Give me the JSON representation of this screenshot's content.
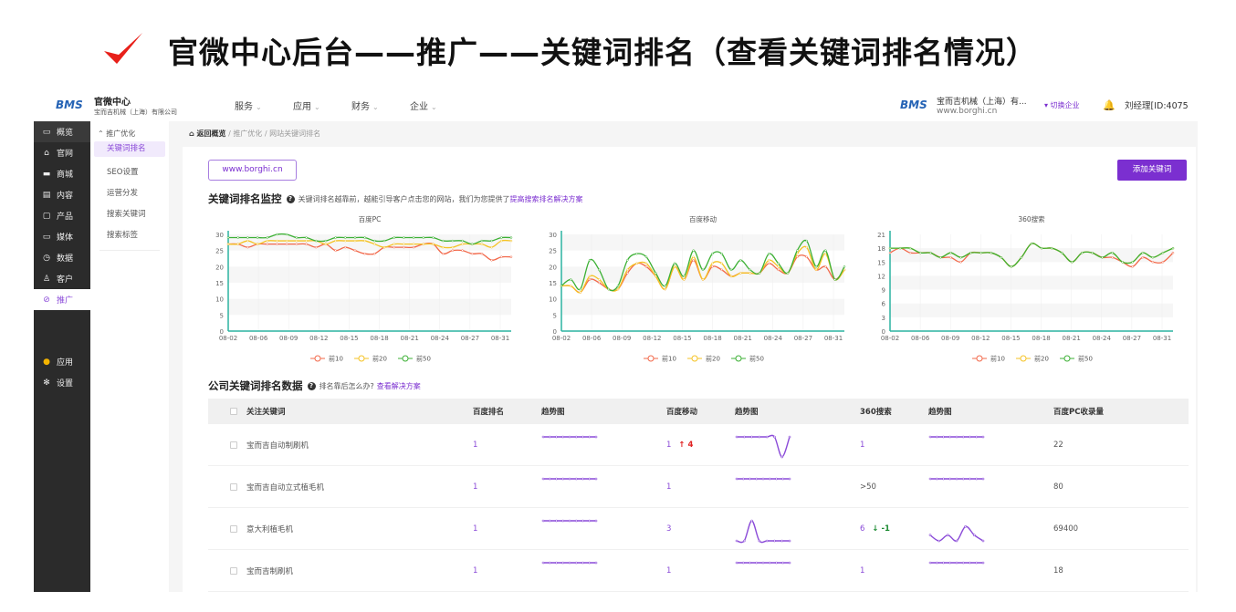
{
  "headline": {
    "text": "官微中心后台——推广——关键词排名（查看关键词排名情况）",
    "check_color": "#e8201a"
  },
  "topbar": {
    "logo": "BMS",
    "brand_title": "官微中心",
    "brand_sub": "宝而吉机械（上海）有限公司",
    "nav": [
      "服务",
      "应用",
      "财务",
      "企业"
    ],
    "company_name": "宝而吉机械（上海）有...",
    "company_site": "www.borghi.cn",
    "switch_label": "▾ 切换企业",
    "user": "刘经理[ID:4075"
  },
  "sidebar": {
    "items": [
      {
        "icon": "overview-icon",
        "glyph": "▭",
        "label": "概览"
      },
      {
        "icon": "website-icon",
        "glyph": "⌂",
        "label": "官网"
      },
      {
        "icon": "shop-icon",
        "glyph": "▬",
        "label": "商城"
      },
      {
        "icon": "content-icon",
        "glyph": "▤",
        "label": "内容"
      },
      {
        "icon": "product-icon",
        "glyph": "▢",
        "label": "产品"
      },
      {
        "icon": "media-icon",
        "glyph": "▭",
        "label": "媒体"
      },
      {
        "icon": "data-icon",
        "glyph": "◷",
        "label": "数据"
      },
      {
        "icon": "customer-icon",
        "glyph": "♙",
        "label": "客户"
      },
      {
        "icon": "promotion-icon",
        "glyph": "⊘",
        "label": "推广"
      }
    ],
    "bottom": [
      {
        "icon": "apps-icon",
        "glyph": "●",
        "label": "应用"
      },
      {
        "icon": "settings-icon",
        "glyph": "✻",
        "label": "设置"
      }
    ]
  },
  "subnav": {
    "group": "推广优化",
    "items": [
      "关键词排名",
      "SEO设置",
      "运营分发",
      "搜索关键词",
      "搜索标签"
    ]
  },
  "breadcrumb": [
    "返回概览",
    "推广优化",
    "网站关键词排名"
  ],
  "main": {
    "site_button": "www.borghi.cn",
    "add_button": "添加关键词",
    "monitor_title": "关键词排名监控",
    "monitor_desc": "关键词排名越靠前，越能引导客户点击您的网站，我们为您提供了",
    "monitor_link": "提高搜索排名解决方案",
    "table_title": "公司关键词排名数据",
    "table_desc": "排名靠后怎么办?",
    "table_link": "查看解决方案"
  },
  "chart_data": [
    {
      "type": "line",
      "title": "百度PC",
      "x_ticks": [
        "08-02",
        "08-06",
        "08-09",
        "08-12",
        "08-15",
        "08-18",
        "08-21",
        "08-24",
        "08-27",
        "08-31"
      ],
      "ylim": [
        0,
        30
      ],
      "yticks": [
        0,
        5,
        10,
        15,
        20,
        25,
        30
      ],
      "legend": "bottom",
      "series": [
        {
          "name": "前10",
          "color": "#f2684a",
          "values": [
            27,
            27,
            26,
            27,
            27,
            27,
            27,
            27,
            27,
            26,
            27,
            25,
            26,
            25,
            24,
            24,
            26,
            26,
            26,
            26,
            27,
            27,
            24,
            25,
            25,
            24,
            24,
            22,
            23,
            23
          ]
        },
        {
          "name": "前20",
          "color": "#f5c324",
          "values": [
            27,
            27,
            28,
            27,
            28,
            28,
            28,
            28,
            28,
            28,
            27,
            28,
            28,
            28,
            28,
            27,
            26,
            27,
            27,
            27,
            27,
            27,
            26,
            26,
            27,
            27,
            27,
            26,
            28,
            28
          ]
        },
        {
          "name": "前50",
          "color": "#3cb034",
          "values": [
            29,
            29,
            29,
            29,
            29,
            30,
            30,
            29,
            29,
            28,
            28,
            29,
            29,
            29,
            29,
            28,
            28,
            29,
            29,
            29,
            29,
            29,
            28,
            28,
            28,
            27,
            28,
            28,
            29,
            29
          ]
        }
      ]
    },
    {
      "type": "line",
      "title": "百度移动",
      "x_ticks": [
        "08-02",
        "08-06",
        "08-09",
        "08-12",
        "08-15",
        "08-18",
        "08-21",
        "08-24",
        "08-27",
        "08-31"
      ],
      "ylim": [
        0,
        30
      ],
      "yticks": [
        0,
        5,
        10,
        15,
        20,
        25,
        30
      ],
      "legend": "bottom",
      "series": [
        {
          "name": "前10",
          "color": "#f2684a",
          "values": [
            14,
            14,
            12,
            16,
            15,
            13,
            13,
            18,
            21,
            20,
            17,
            13,
            20,
            16,
            22,
            16,
            20,
            19,
            17,
            18,
            18,
            18,
            21,
            19,
            18,
            23,
            23,
            19,
            20,
            16,
            19
          ]
        },
        {
          "name": "前20",
          "color": "#f5c324",
          "values": [
            14,
            14,
            12,
            17,
            16,
            13,
            13,
            19,
            21,
            21,
            17,
            13,
            20,
            16,
            23,
            16,
            21,
            21,
            17,
            18,
            18,
            18,
            22,
            20,
            18,
            24,
            26,
            19,
            24,
            16,
            19
          ]
        },
        {
          "name": "前50",
          "color": "#3cb034",
          "values": [
            14,
            16,
            13,
            22,
            19,
            13,
            14,
            22,
            24,
            23,
            18,
            14,
            21,
            17,
            25,
            19,
            24,
            24,
            19,
            22,
            19,
            18,
            24,
            21,
            18,
            25,
            28,
            20,
            25,
            16,
            20
          ]
        }
      ]
    },
    {
      "type": "line",
      "title": "360搜索",
      "x_ticks": [
        "08-02",
        "08-06",
        "08-09",
        "08-12",
        "08-15",
        "08-18",
        "08-21",
        "08-24",
        "08-27",
        "08-31"
      ],
      "ylim": [
        0,
        21
      ],
      "yticks": [
        0,
        3,
        6,
        9,
        12,
        15,
        18,
        21
      ],
      "legend": "bottom",
      "series": [
        {
          "name": "前10",
          "color": "#f2684a",
          "values": [
            17,
            18,
            17,
            17,
            17,
            16,
            16,
            15,
            17,
            17,
            17,
            16,
            14,
            16,
            19,
            18,
            18,
            17,
            15,
            17,
            17,
            16,
            16,
            15,
            14,
            16,
            15,
            15,
            17
          ]
        },
        {
          "name": "前20",
          "color": "#f5c324",
          "values": [
            18,
            18,
            18,
            17,
            17,
            16,
            17,
            16,
            17,
            17,
            17,
            16,
            14,
            16,
            19,
            18,
            18,
            17,
            15,
            17,
            17,
            16,
            17,
            15,
            15,
            17,
            16,
            17,
            18
          ]
        },
        {
          "name": "前50",
          "color": "#3cb034",
          "values": [
            18,
            18,
            18,
            17,
            17,
            16,
            17,
            16,
            17,
            17,
            17,
            16,
            14,
            16,
            19,
            18,
            18,
            17,
            15,
            17,
            17,
            16,
            17,
            15,
            15,
            17,
            16,
            17,
            18
          ]
        }
      ]
    }
  ],
  "table": {
    "headers": [
      "关注关键词",
      "百度排名",
      "趋势图",
      "百度移动",
      "趋势图",
      "360搜索",
      "趋势图",
      "百度PC收录量"
    ],
    "rows": [
      {
        "keyword": "宝而吉自动制刷机",
        "baidu": "1",
        "baidu_trend": [
          1,
          1,
          1,
          1,
          1,
          1,
          1,
          1,
          1
        ],
        "mobile": "1",
        "mobile_change": "4",
        "mobile_dir": "up",
        "mobile_trend": [
          1,
          1,
          1,
          1,
          1,
          1,
          5,
          1
        ],
        "s360": "1",
        "s360_change": "",
        "s360_dir": "",
        "s360_trend": [
          1,
          1,
          1,
          1,
          1,
          1,
          1,
          1,
          1
        ],
        "pc_index": "22"
      },
      {
        "keyword": "宝而吉自动立式植毛机",
        "baidu": "1",
        "baidu_trend": [
          1,
          1,
          1,
          1,
          1,
          1,
          1,
          1,
          1
        ],
        "mobile": "1",
        "mobile_change": "",
        "mobile_dir": "",
        "mobile_trend": [
          1,
          1,
          1,
          1,
          1,
          1,
          1,
          1,
          1
        ],
        "s360": ">50",
        "s360_change": "",
        "s360_dir": "",
        "s360_trend": [
          1,
          1,
          1,
          1,
          1,
          1,
          1,
          1,
          1
        ],
        "pc_index": "80"
      },
      {
        "keyword": "意大利植毛机",
        "baidu": "1",
        "baidu_trend": [
          1,
          1,
          1,
          1,
          1,
          1,
          1,
          1,
          1
        ],
        "mobile": "3",
        "mobile_change": "",
        "mobile_dir": "",
        "mobile_trend": [
          3,
          3,
          1,
          3,
          3,
          3,
          3,
          3
        ],
        "s360": "6",
        "s360_change": "-1",
        "s360_dir": "down",
        "s360_trend": [
          6,
          8,
          6,
          8,
          3,
          6,
          8
        ],
        "pc_index": "69400"
      },
      {
        "keyword": "宝而吉制刷机",
        "baidu": "1",
        "baidu_trend": [
          1,
          1,
          1,
          1,
          1,
          1,
          1,
          1,
          1
        ],
        "mobile": "1",
        "mobile_change": "",
        "mobile_dir": "",
        "mobile_trend": [
          1,
          1,
          1,
          1,
          1,
          1,
          1,
          1,
          1
        ],
        "s360": "1",
        "s360_change": "",
        "s360_dir": "",
        "s360_trend": [
          1,
          1,
          1,
          1,
          1,
          1,
          1,
          1,
          1
        ],
        "pc_index": "18"
      }
    ]
  },
  "colors": {
    "accent": "#7b2fd0",
    "axis": "#2bb3a0",
    "sparkline": "#8a4ad8"
  }
}
